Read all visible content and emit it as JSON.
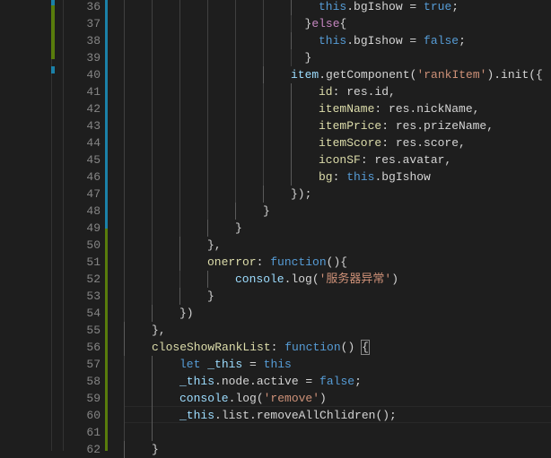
{
  "colors": {
    "keyword": "#569cd6",
    "string": "#ce9178",
    "control": "#c586c0",
    "modified": "#1b81a8",
    "added": "#587c0c"
  },
  "lines": [
    {
      "n": "36",
      "indent": 28,
      "tokens": [
        [
          "k",
          "this"
        ],
        [
          "t",
          ".bgIshow = "
        ],
        [
          "k",
          "true"
        ],
        [
          "t",
          ";"
        ]
      ]
    },
    {
      "n": "37",
      "indent": 26,
      "tokens": [
        [
          "t",
          "}"
        ],
        [
          "c",
          "else"
        ],
        [
          "t",
          "{"
        ]
      ]
    },
    {
      "n": "38",
      "indent": 28,
      "tokens": [
        [
          "k",
          "this"
        ],
        [
          "t",
          ".bgIshow = "
        ],
        [
          "k",
          "false"
        ],
        [
          "t",
          ";"
        ]
      ]
    },
    {
      "n": "39",
      "indent": 26,
      "tokens": [
        [
          "t",
          "}"
        ]
      ]
    },
    {
      "n": "40",
      "indent": 24,
      "tokens": [
        [
          "v",
          "item"
        ],
        [
          "t",
          ".getComponent("
        ],
        [
          "s",
          "'rankItem'"
        ],
        [
          "t",
          ").init({"
        ]
      ]
    },
    {
      "n": "41",
      "indent": 28,
      "tokens": [
        [
          "p",
          "id"
        ],
        [
          "t",
          ": res.id,"
        ]
      ]
    },
    {
      "n": "42",
      "indent": 28,
      "tokens": [
        [
          "p",
          "itemName"
        ],
        [
          "t",
          ": res.nickName,"
        ]
      ]
    },
    {
      "n": "43",
      "indent": 28,
      "tokens": [
        [
          "p",
          "itemPrice"
        ],
        [
          "t",
          ": res.prizeName,"
        ]
      ]
    },
    {
      "n": "44",
      "indent": 28,
      "tokens": [
        [
          "p",
          "itemScore"
        ],
        [
          "t",
          ": res.score,"
        ]
      ]
    },
    {
      "n": "45",
      "indent": 28,
      "tokens": [
        [
          "p",
          "iconSF"
        ],
        [
          "t",
          ": res.avatar,"
        ]
      ]
    },
    {
      "n": "46",
      "indent": 28,
      "tokens": [
        [
          "p",
          "bg"
        ],
        [
          "t",
          ": "
        ],
        [
          "k",
          "this"
        ],
        [
          "t",
          ".bgIshow"
        ]
      ]
    },
    {
      "n": "47",
      "indent": 24,
      "tokens": [
        [
          "t",
          "});"
        ]
      ]
    },
    {
      "n": "48",
      "indent": 20,
      "tokens": [
        [
          "t",
          "}"
        ]
      ]
    },
    {
      "n": "49",
      "indent": 16,
      "tokens": [
        [
          "t",
          "}"
        ]
      ]
    },
    {
      "n": "50",
      "indent": 12,
      "tokens": [
        [
          "t",
          "},"
        ]
      ]
    },
    {
      "n": "51",
      "indent": 12,
      "tokens": [
        [
          "p",
          "onerror"
        ],
        [
          "t",
          ": "
        ],
        [
          "k",
          "function"
        ],
        [
          "t",
          "(){"
        ]
      ]
    },
    {
      "n": "52",
      "indent": 16,
      "tokens": [
        [
          "v",
          "console"
        ],
        [
          "t",
          ".log("
        ],
        [
          "s",
          "'服务器异常'"
        ],
        [
          "t",
          ")"
        ]
      ]
    },
    {
      "n": "53",
      "indent": 12,
      "tokens": [
        [
          "t",
          "}"
        ]
      ]
    },
    {
      "n": "54",
      "indent": 8,
      "tokens": [
        [
          "t",
          "})"
        ]
      ]
    },
    {
      "n": "55",
      "indent": 4,
      "tokens": [
        [
          "t",
          "},"
        ]
      ]
    },
    {
      "n": "56",
      "indent": 4,
      "tokens": [
        [
          "p",
          "closeShowRankList"
        ],
        [
          "t",
          ": "
        ],
        [
          "k",
          "function"
        ],
        [
          "t",
          "() "
        ],
        [
          "t",
          "{"
        ]
      ]
    },
    {
      "n": "57",
      "indent": 8,
      "tokens": [
        [
          "k",
          "let"
        ],
        [
          "t",
          " "
        ],
        [
          "v",
          "_this"
        ],
        [
          "t",
          " = "
        ],
        [
          "k",
          "this"
        ]
      ]
    },
    {
      "n": "58",
      "indent": 8,
      "tokens": [
        [
          "v",
          "_this"
        ],
        [
          "t",
          ".node.active = "
        ],
        [
          "k",
          "false"
        ],
        [
          "t",
          ";"
        ]
      ]
    },
    {
      "n": "59",
      "indent": 8,
      "tokens": [
        [
          "v",
          "console"
        ],
        [
          "t",
          ".log("
        ],
        [
          "s",
          "'remove'"
        ],
        [
          "t",
          ")"
        ]
      ]
    },
    {
      "n": "60",
      "indent": 8,
      "tokens": [
        [
          "v",
          "_this"
        ],
        [
          "t",
          ".list.removeAllChlidren();"
        ]
      ]
    },
    {
      "n": "61",
      "indent": 0,
      "tokens": []
    },
    {
      "n": "62",
      "indent": 4,
      "tokens": [
        [
          "t",
          "}"
        ]
      ]
    }
  ]
}
